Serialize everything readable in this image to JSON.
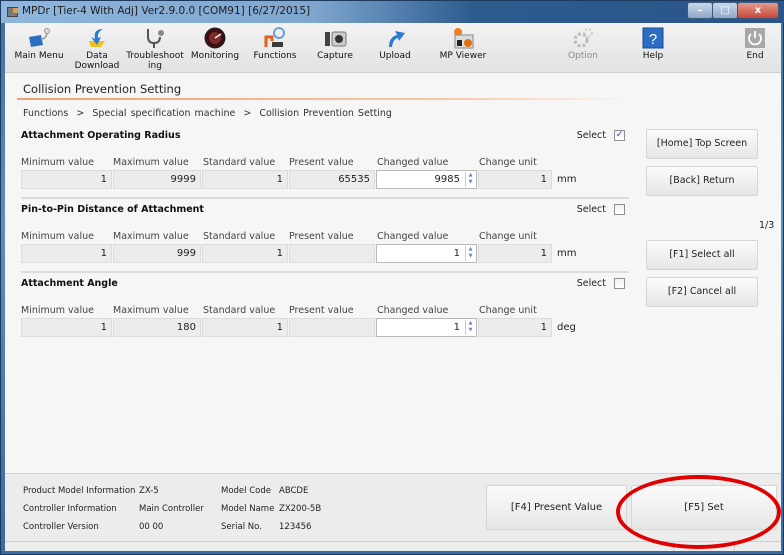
{
  "window": {
    "title": "MPDr [Tier-4 With Adj] Ver2.9.0.0 [COM91] [6/27/2015]",
    "controls": {
      "minimize": "–",
      "maximize": "□",
      "close": "x"
    }
  },
  "toolbar": {
    "items": [
      {
        "label": "Main Menu",
        "icon": "main-menu-icon",
        "enabled": true
      },
      {
        "label": "Data Download",
        "icon": "data-download-icon",
        "enabled": true
      },
      {
        "label": "Troubleshooting",
        "icon": "stethoscope-icon",
        "enabled": true
      },
      {
        "label": "Monitoring",
        "icon": "monitoring-gauge-icon",
        "enabled": true
      },
      {
        "label": "Functions",
        "icon": "functions-icon",
        "enabled": true
      },
      {
        "label": "Capture",
        "icon": "camera-icon",
        "enabled": true
      },
      {
        "label": "Upload",
        "icon": "upload-arrow-icon",
        "enabled": true
      },
      {
        "label": "MP Viewer",
        "icon": "mp-viewer-icon",
        "enabled": true
      },
      {
        "label": "Option",
        "icon": "gear-icon",
        "enabled": false
      },
      {
        "label": "Help",
        "icon": "help-icon",
        "enabled": true
      },
      {
        "label": "End",
        "icon": "power-icon",
        "enabled": true
      }
    ],
    "labels_display": {
      "main_menu": "Main Menu",
      "data_download_1": "Data",
      "data_download_2": "Download",
      "troubleshooting_1": "Troubleshoot",
      "troubleshooting_2": "ing",
      "monitoring": "Monitoring",
      "functions": "Functions",
      "capture": "Capture",
      "upload": "Upload",
      "mp_viewer": "MP Viewer",
      "option": "Option",
      "help": "Help",
      "end": "End"
    }
  },
  "page": {
    "title": "Collision Prevention Setting",
    "breadcrumb": [
      "Functions",
      "Special specification machine",
      "Collision Prevention Setting"
    ],
    "breadcrumb_separator": ">"
  },
  "columns": {
    "min": "Minimum value",
    "max": "Maximum value",
    "standard": "Standard value",
    "present": "Present value",
    "changed": "Changed value",
    "unit": "Change unit"
  },
  "select_label": "Select",
  "sections": [
    {
      "title": "Attachment Operating Radius",
      "selected": true,
      "min": "1",
      "max": "9999",
      "standard": "1",
      "present": "65535",
      "changed": "9985",
      "change_unit": "1",
      "unit": "mm"
    },
    {
      "title": "Pin-to-Pin Distance of Attachment",
      "selected": false,
      "min": "1",
      "max": "999",
      "standard": "1",
      "present": "",
      "changed": "1",
      "change_unit": "1",
      "unit": "mm"
    },
    {
      "title": "Attachment Angle",
      "selected": false,
      "min": "1",
      "max": "180",
      "standard": "1",
      "present": "",
      "changed": "1",
      "change_unit": "1",
      "unit": "deg"
    }
  ],
  "side_buttons": {
    "home": "[Home] Top Screen",
    "back": "[Back] Return",
    "page_indicator": "1/3",
    "select_all": "[F1] Select all",
    "cancel_all": "[F2] Cancel all"
  },
  "footer": {
    "product_model_label": "Product Model Information",
    "product_model_value": "ZX-5",
    "controller_info_label": "Controller Information",
    "controller_info_value": "Main Controller",
    "controller_version_label": "Controller Version",
    "controller_version_value": "00 00",
    "model_code_label": "Model Code",
    "model_code_value": "ABCDE",
    "model_name_label": "Model Name",
    "model_name_value": "ZX200-5B",
    "serial_label": "Serial No.",
    "serial_value": "123456"
  },
  "bottom_buttons": {
    "present_value": "[F4] Present Value",
    "set": "[F5] Set"
  },
  "annotation": {
    "highlight_target": "[F5] Set",
    "highlight_color": "#e00000"
  }
}
